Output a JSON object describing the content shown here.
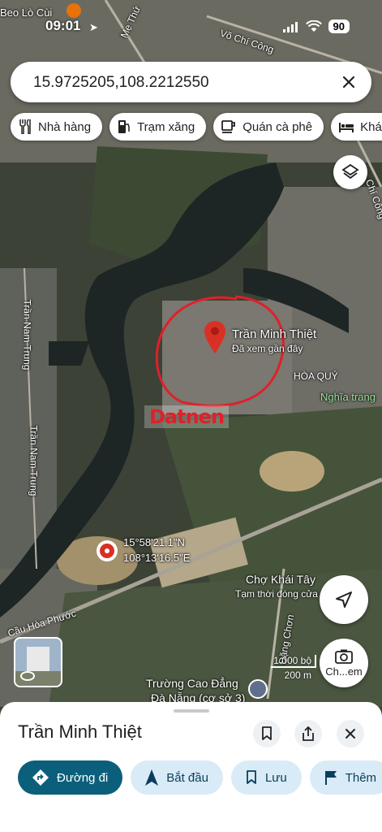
{
  "status": {
    "time": "09:01",
    "battery": "90"
  },
  "search": {
    "value": "15.9725205,108.2212550"
  },
  "chips": [
    {
      "label": "Nhà hàng",
      "icon": "restaurant-icon"
    },
    {
      "label": "Trạm xăng",
      "icon": "gas-station-icon"
    },
    {
      "label": "Quán cà phê",
      "icon": "coffee-icon"
    },
    {
      "label": "Khác",
      "icon": "bed-icon"
    }
  ],
  "map": {
    "labels": {
      "beo_lo_cui": "Beo Lò Cùi",
      "me_thu": "Mẹ Thứ",
      "vo_chi_cong_top": "Võ Chí Công",
      "chi_cong": "Chí Công",
      "tran_nam_trung_1": "Trần Nam Trung",
      "tran_nam_trung_2": "Trần Nam Trung",
      "pin_name": "Trần Minh Thiệt",
      "pin_sub": "Đã xem gần đây",
      "hoa_quy": "HÒA QUÝ",
      "nghia_trang": "Nghĩa trang",
      "watermark": "Datnen",
      "coord_lat": "15°58'21.1\"N",
      "coord_lng": "108°13'16.5\"E",
      "cho_khai_tay": "Chợ Khái Tây",
      "tam_thoi": "Tạm thời đóng cửa",
      "cau_hoa_phuoc": "Cầu Hòa Phước",
      "dang_chon": "Đặng Chơn",
      "truong_1": "Trường Cao Đẳng",
      "truong_2": "Đà Nẵng (cơ sở 3)"
    },
    "scale_ft": "1.000 bộ",
    "scale_m": "200 m",
    "streetview_label": "Ch...em"
  },
  "sheet": {
    "title": "Trần Minh Thiệt",
    "actions": [
      {
        "label": "Đường đi",
        "icon": "directions-icon"
      },
      {
        "label": "Bắt đầu",
        "icon": "navigation-icon"
      },
      {
        "label": "Lưu",
        "icon": "bookmark-icon"
      },
      {
        "label": "Thêm",
        "icon": "flag-icon"
      }
    ]
  },
  "colors": {
    "accent": "#0b5f7a",
    "pin": "#d93025",
    "circle": "#e0202a"
  }
}
